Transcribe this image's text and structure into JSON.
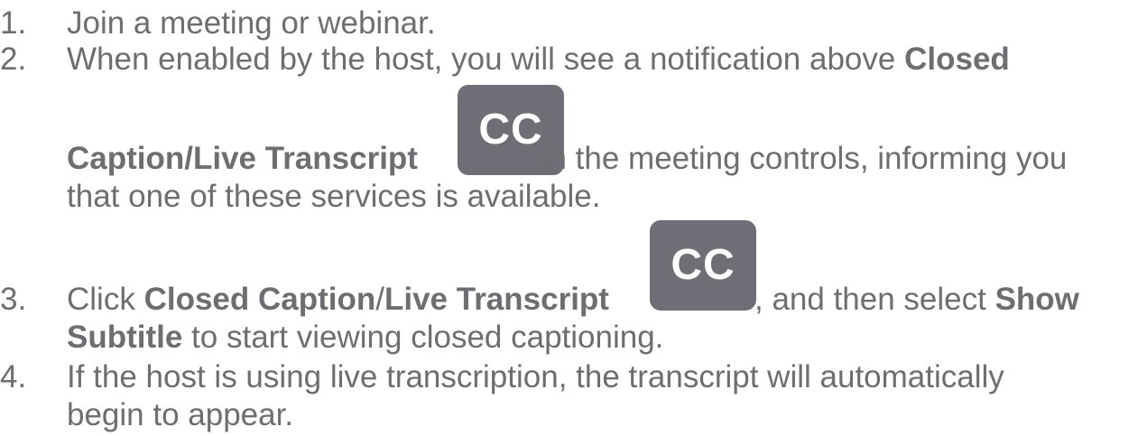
{
  "steps": [
    {
      "number": "1.",
      "lines": [
        {
          "text": "Join a meeting or webinar."
        }
      ]
    },
    {
      "number": "2.",
      "line1_plain": "When enabled by the host, you will see a notification above ",
      "line1_bold": "Closed",
      "line2_bold": "Caption/Live Transcript",
      "line2_plain": " in the meeting controls, informing you",
      "line3_plain": "that one of these services is available.",
      "icon_label": "CC"
    },
    {
      "number": "3.",
      "line1_plain_a": "Click ",
      "line1_bold_a": "Closed Caption",
      "line1_plain_b": "/",
      "line1_bold_b": "Live Transcript",
      "line1_plain_c": ", and then select ",
      "line1_bold_c": "Show",
      "line2_bold": "Subtitle",
      "line2_plain": " to start viewing closed captioning.",
      "icon_label": "CC"
    },
    {
      "number": "4.",
      "line1_plain": "If the host is using live transcription, the transcript will automatically",
      "line2_plain": "begin to appear."
    }
  ],
  "colors": {
    "text": "#6d6d72",
    "icon_bg": "#6f6d75",
    "icon_fg": "#ffffff"
  }
}
